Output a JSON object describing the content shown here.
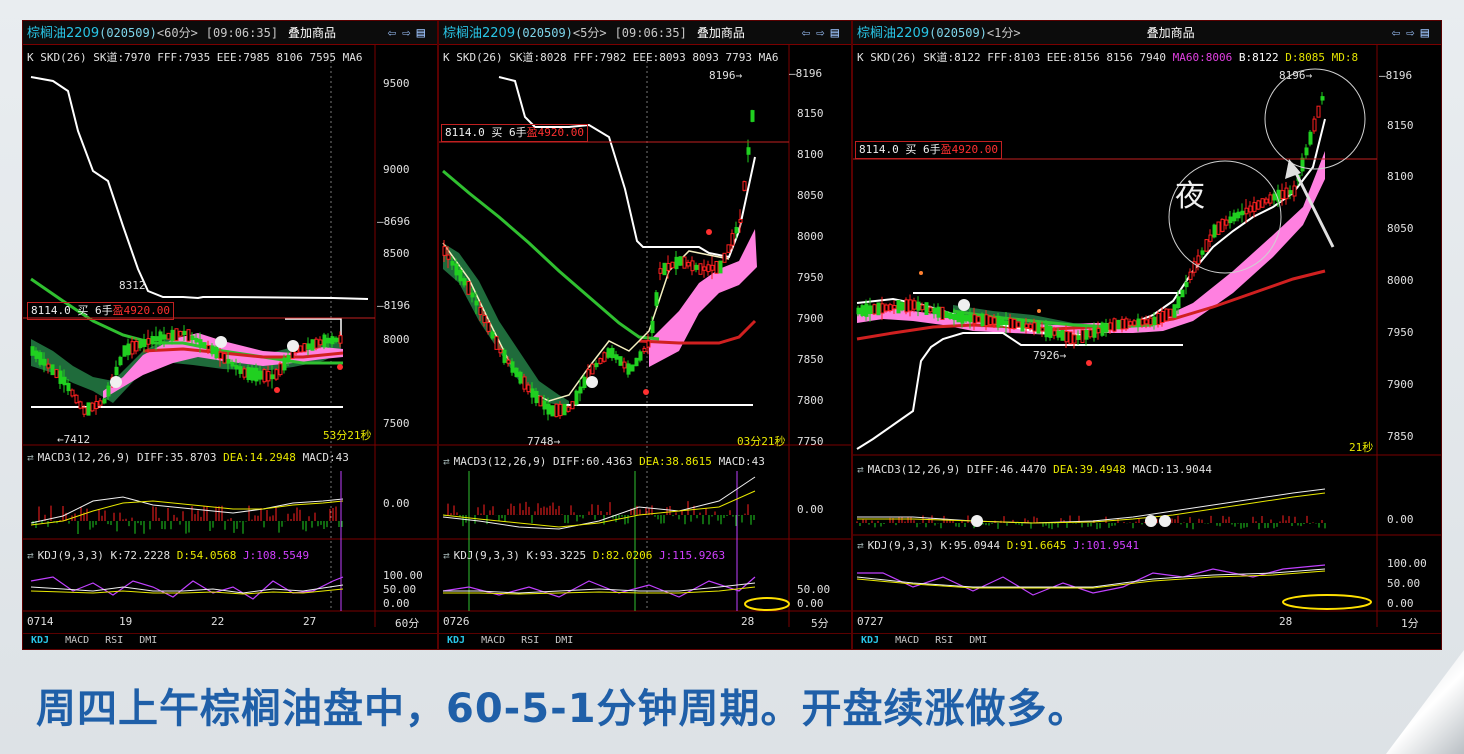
{
  "caption": "周四上午棕榈油盘中，60-5-1分钟周期。开盘续涨做多。",
  "colors": {
    "bg": "#000000",
    "grid": "#7a0000",
    "up": "#ff2020",
    "down": "#20d020",
    "ma_white": "#ffffff",
    "ma_green": "#30c030",
    "ma_red": "#d02020",
    "band_pink": "#ff80e0",
    "band_green": "#1f6b3b",
    "caption": "#1f5fa8"
  },
  "panels": [
    {
      "name": "棕榈油2209",
      "code": "(020509)",
      "period": "<60分>",
      "time": "[09:06:35]",
      "overlay": "叠加商品",
      "kline": "K SKD(26) SK道:7970 FFF:7935 EEE:7985 8106 7595 MA6",
      "y_ticks": [
        "9500",
        "9000",
        "8696",
        "8500",
        "8196",
        "8000",
        "7500"
      ],
      "hi_label": "8312",
      "lo_label": "7412",
      "order": {
        "price": "8114.0",
        "side": "买",
        "qty": "6手",
        "pl": "盈4920.00"
      },
      "countdown": "53分21秒",
      "macd": {
        "label": "MACD3(12,26,9)",
        "diff": "DIFF:35.8703",
        "dea": "DEA:14.2948",
        "macd": "MACD:43",
        "zero": "0.00"
      },
      "kdj": {
        "label": "KDJ(9,3,3)",
        "k": "K:72.2228",
        "d": "D:54.0568",
        "j": "J:108.5549",
        "ticks": [
          "100.00",
          "50.00",
          "0.00"
        ]
      },
      "x_ticks": [
        "0714",
        "19",
        "22",
        "27"
      ],
      "x_period": "60分",
      "tabs": [
        "KDJ",
        "MACD",
        "RSI",
        "DMI"
      ]
    },
    {
      "name": "棕榈油2209",
      "code": "(020509)",
      "period": "<5分>",
      "time": "[09:06:35]",
      "overlay": "叠加商品",
      "kline": "K SKD(26) SK道:8028 FFF:7982 EEE:8093 8093 7793 MA6",
      "y_ticks": [
        "8196",
        "8150",
        "8100",
        "8050",
        "8000",
        "7950",
        "7900",
        "7850",
        "7800",
        "7750"
      ],
      "hi_label": "8196",
      "lo_label": "7748",
      "order": {
        "price": "8114.0",
        "side": "买",
        "qty": "6手",
        "pl": "盈4920.00"
      },
      "countdown": "03分21秒",
      "macd": {
        "label": "MACD3(12,26,9)",
        "diff": "DIFF:60.4363",
        "dea": "DEA:38.8615",
        "macd": "MACD:43",
        "zero": "0.00"
      },
      "kdj": {
        "label": "KDJ(9,3,3)",
        "k": "K:93.3225",
        "d": "D:82.0206",
        "j": "J:115.9263",
        "ticks": [
          "50.00",
          "0.00"
        ]
      },
      "x_ticks": [
        "0726",
        "28"
      ],
      "x_period": "5分",
      "tabs": [
        "KDJ",
        "MACD",
        "RSI",
        "DMI"
      ]
    },
    {
      "name": "棕榈油2209",
      "code": "(020509)",
      "period": "<1分>",
      "time": "",
      "overlay": "叠加商品",
      "kline_a": "K SKD(26) SK道:8122 FFF:8103 EEE:8156 8156 7940 ",
      "kline_ma60": "MA60:8006",
      "kline_b": " B:8122 ",
      "kline_md": "D:8085 MD:8",
      "y_ticks": [
        "8196",
        "8150",
        "8100",
        "8050",
        "8000",
        "7950",
        "7900",
        "7850"
      ],
      "hi_label": "8196",
      "lo_label": "7926",
      "order": {
        "price": "8114.0",
        "side": "买",
        "qty": "6手",
        "pl": "盈4920.00"
      },
      "countdown": "21秒",
      "night": "夜",
      "macd": {
        "label": "MACD3(12,26,9)",
        "diff": "DIFF:46.4470",
        "dea": "DEA:39.4948",
        "macd": "MACD:13.9044",
        "zero": "0.00"
      },
      "kdj": {
        "label": "KDJ(9,3,3)",
        "k": "K:95.0944",
        "d": "D:91.6645",
        "j": "J:101.9541",
        "ticks": [
          "100.00",
          "50.00",
          "0.00"
        ]
      },
      "x_ticks": [
        "0727",
        "28"
      ],
      "x_period": "1分",
      "tabs": [
        "KDJ",
        "MACD",
        "RSI",
        "DMI"
      ]
    }
  ]
}
